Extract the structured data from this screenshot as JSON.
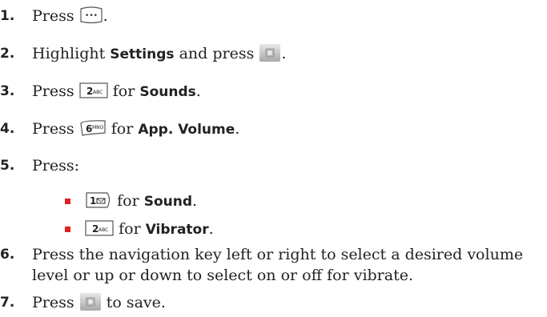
{
  "steps": [
    {
      "num": "1.",
      "pre": "Press",
      "post": "."
    },
    {
      "num": "2.",
      "pre": "Highlight",
      "bold": "Settings",
      "mid": "and press",
      "post": "."
    },
    {
      "num": "3.",
      "pre": "Press",
      "mid": "for",
      "bold": "Sounds",
      "post": "."
    },
    {
      "num": "4.",
      "pre": "Press",
      "mid": "for",
      "bold": "App. Volume",
      "post": "."
    },
    {
      "num": "5.",
      "pre": "Press:"
    },
    {
      "num": "6.",
      "line1": "Press the navigation key left or right to select a desired volume",
      "line2": "level or up or down to select on or off for vibrate."
    },
    {
      "num": "7.",
      "pre": "Press",
      "post": "to save."
    }
  ],
  "substeps": [
    {
      "mid": "for",
      "bold": "Sound",
      "post": "."
    },
    {
      "mid": "for",
      "bold": "Vibrator",
      "post": "."
    }
  ],
  "keys": {
    "menu": "•••",
    "two": "2",
    "two_sub": "ABC",
    "six": "6",
    "six_sub": "MNO",
    "one": "1"
  },
  "colors": {
    "bullet": "#e02020",
    "text": "#222222"
  }
}
